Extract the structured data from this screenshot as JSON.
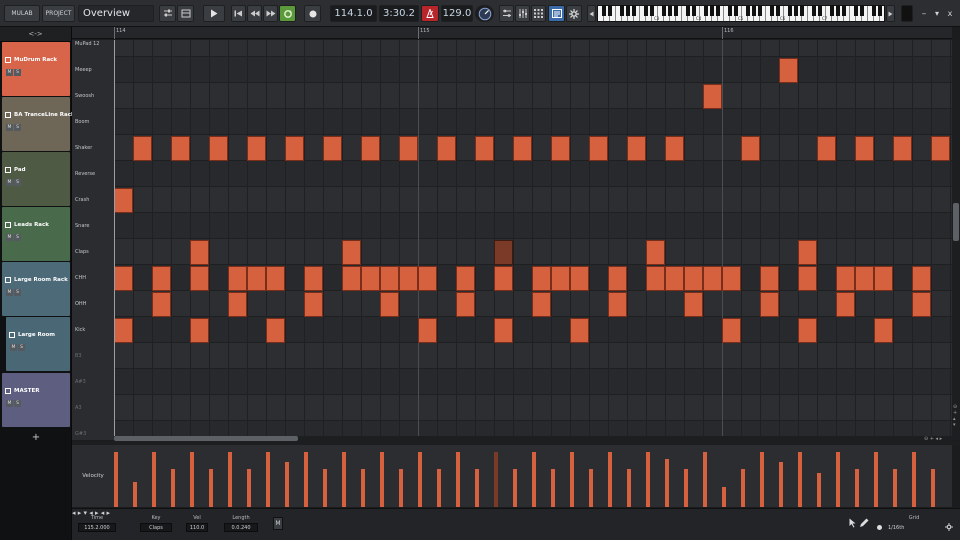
{
  "toolbar": {
    "mulab_label": "MULAB",
    "project_label": "PROJECT",
    "title": "Overview",
    "position": "114.1.0",
    "time": "3:30.2",
    "tempo": "129.0",
    "record_color": "#b8262b",
    "loop_color": "#5a9a3a",
    "editor_color": "#3b6aa8",
    "keyboard_octaves": [
      "C3",
      "C4",
      "C5",
      "C6",
      "C7"
    ]
  },
  "window_controls": {
    "minimize": "–",
    "maximize": "▾",
    "close": "x"
  },
  "tracks_header": "<->",
  "tracks": [
    {
      "name": "MuDrum Rack",
      "color": "#d8654a"
    },
    {
      "name": "BA TranceLine Rack",
      "color": "#6e6657"
    },
    {
      "name": "Pad",
      "color": "#4f5a45"
    },
    {
      "name": "Leads Rack",
      "color": "#4a6a4c"
    },
    {
      "name": "Large Room Rack",
      "color": "#4c6a78"
    },
    {
      "name": "Large Room",
      "color": "#4a6775"
    },
    {
      "name": "MASTER",
      "color": "#5e5f80"
    }
  ],
  "add_track": "+",
  "ruler": {
    "bars": [
      "114",
      "115",
      "116"
    ]
  },
  "lanes": [
    {
      "name": "MuPad 12",
      "dim": false
    },
    {
      "name": "Meeep",
      "dim": false
    },
    {
      "name": "Swoosh",
      "dim": false
    },
    {
      "name": "Boom",
      "dim": false
    },
    {
      "name": "Shaker",
      "dim": false
    },
    {
      "name": "Reverse",
      "dim": false
    },
    {
      "name": "Crash",
      "dim": false
    },
    {
      "name": "Snare",
      "dim": false
    },
    {
      "name": "Claps",
      "dim": false
    },
    {
      "name": "CHH",
      "dim": false
    },
    {
      "name": "OHH",
      "dim": false
    },
    {
      "name": "Kick",
      "dim": false
    },
    {
      "name": "B3",
      "dim": true
    },
    {
      "name": "A#3",
      "dim": true
    },
    {
      "name": "A3",
      "dim": true
    },
    {
      "name": "G#3",
      "dim": true
    }
  ],
  "notes": {
    "Meeep": [
      35
    ],
    "Swoosh": [
      31
    ],
    "Shaker": [
      1,
      3,
      5,
      7,
      9,
      11,
      13,
      15,
      17,
      19,
      21,
      23,
      25,
      27,
      29,
      33,
      37,
      39,
      41,
      43
    ],
    "Crash": [
      0
    ],
    "Claps": [
      4,
      12,
      20,
      28,
      36
    ],
    "Claps_dark": [
      20
    ],
    "CHH": [
      0,
      2,
      4,
      6,
      7,
      8,
      10,
      12,
      13,
      14,
      15,
      16,
      18,
      20,
      22,
      23,
      24,
      26,
      28,
      29,
      30,
      31,
      32,
      34,
      36,
      38,
      39,
      40,
      42
    ],
    "OHH": [
      2,
      6,
      10,
      14,
      18,
      22,
      26,
      30,
      34,
      38,
      42
    ],
    "Kick": [
      0,
      4,
      8,
      16,
      20,
      24,
      32,
      36,
      40
    ]
  },
  "velocity": {
    "label": "Velocity",
    "bars": [
      {
        "step": 0,
        "v": 0.88
      },
      {
        "step": 1,
        "v": 0.4
      },
      {
        "step": 2,
        "v": 0.88
      },
      {
        "step": 3,
        "v": 0.62
      },
      {
        "step": 4,
        "v": 0.88
      },
      {
        "step": 5,
        "v": 0.62
      },
      {
        "step": 6,
        "v": 0.88
      },
      {
        "step": 7,
        "v": 0.62
      },
      {
        "step": 8,
        "v": 0.88
      },
      {
        "step": 9,
        "v": 0.72
      },
      {
        "step": 10,
        "v": 0.88
      },
      {
        "step": 11,
        "v": 0.62
      },
      {
        "step": 12,
        "v": 0.88
      },
      {
        "step": 13,
        "v": 0.62
      },
      {
        "step": 14,
        "v": 0.88
      },
      {
        "step": 15,
        "v": 0.62
      },
      {
        "step": 16,
        "v": 0.88
      },
      {
        "step": 17,
        "v": 0.62
      },
      {
        "step": 18,
        "v": 0.88
      },
      {
        "step": 19,
        "v": 0.62
      },
      {
        "step": 20,
        "v": 0.88,
        "dark": true
      },
      {
        "step": 21,
        "v": 0.62
      },
      {
        "step": 22,
        "v": 0.88
      },
      {
        "step": 23,
        "v": 0.62
      },
      {
        "step": 24,
        "v": 0.88
      },
      {
        "step": 25,
        "v": 0.62
      },
      {
        "step": 26,
        "v": 0.88
      },
      {
        "step": 27,
        "v": 0.62
      },
      {
        "step": 28,
        "v": 0.88
      },
      {
        "step": 29,
        "v": 0.78
      },
      {
        "step": 30,
        "v": 0.62
      },
      {
        "step": 31,
        "v": 0.88
      },
      {
        "step": 32,
        "v": 0.32
      },
      {
        "step": 33,
        "v": 0.62
      },
      {
        "step": 34,
        "v": 0.88
      },
      {
        "step": 35,
        "v": 0.72
      },
      {
        "step": 36,
        "v": 0.88
      },
      {
        "step": 37,
        "v": 0.55
      },
      {
        "step": 38,
        "v": 0.88
      },
      {
        "step": 39,
        "v": 0.62
      },
      {
        "step": 40,
        "v": 0.88
      },
      {
        "step": 41,
        "v": 0.62
      },
      {
        "step": 42,
        "v": 0.88
      },
      {
        "step": 43,
        "v": 0.62
      }
    ]
  },
  "bottom": {
    "time_label": "Time",
    "time_value": "115.2.000",
    "key_label": "Key",
    "key_value": "Claps",
    "vel_label": "Vel",
    "vel_value": "110.0",
    "length_label": "Length",
    "length_value": "0.0.240",
    "m_button": "M",
    "grid_label": "Grid",
    "grid_value": "1/16th"
  }
}
